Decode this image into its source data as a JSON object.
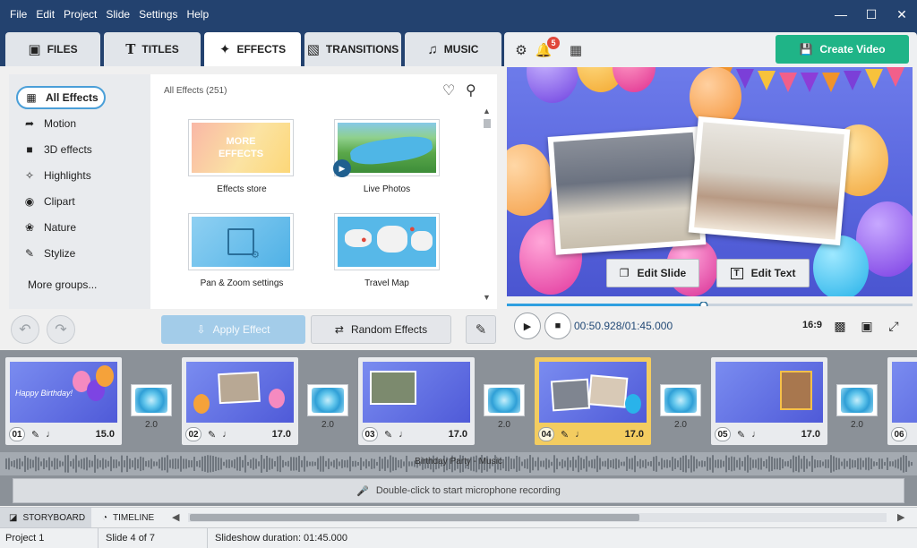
{
  "menu": [
    "File",
    "Edit",
    "Project",
    "Slide",
    "Settings",
    "Help"
  ],
  "tabs": [
    {
      "label": "FILES",
      "icon": "add-file-icon"
    },
    {
      "label": "TITLES",
      "icon": "text-icon"
    },
    {
      "label": "EFFECTS",
      "icon": "effects-icon",
      "active": true
    },
    {
      "label": "TRANSITIONS",
      "icon": "transitions-icon"
    },
    {
      "label": "MUSIC",
      "icon": "music-icon"
    }
  ],
  "notifications_count": "5",
  "create_video_label": "Create Video",
  "groups": [
    {
      "label": "All Effects",
      "active": true
    },
    {
      "label": "Motion"
    },
    {
      "label": "3D effects"
    },
    {
      "label": "Highlights"
    },
    {
      "label": "Clipart"
    },
    {
      "label": "Nature"
    },
    {
      "label": "Stylize"
    }
  ],
  "more_groups_label": "More groups...",
  "effects_header": "All Effects (251)",
  "effects": [
    {
      "label": "Effects store",
      "thumb_text": "MORE EFFECTS"
    },
    {
      "label": "Live Photos"
    },
    {
      "label": "Pan & Zoom settings"
    },
    {
      "label": "Travel Map"
    }
  ],
  "apply_effect_label": "Apply Effect",
  "random_effects_label": "Random Effects",
  "preview": {
    "edit_slide_label": "Edit Slide",
    "edit_text_label": "Edit Text",
    "time_current": "00:50.928",
    "time_total": "01:45.000",
    "aspect_ratio": "16:9",
    "progress": 0.485
  },
  "slides": [
    {
      "num": "01",
      "duration": "15.0",
      "caption": "Happy Birthday!"
    },
    {
      "num": "02",
      "duration": "17.0"
    },
    {
      "num": "03",
      "duration": "17.0"
    },
    {
      "num": "04",
      "duration": "17.0",
      "active": true
    },
    {
      "num": "05",
      "duration": "17.0"
    },
    {
      "num": "06",
      "duration": ""
    }
  ],
  "transitions": [
    {
      "duration": "2.0"
    },
    {
      "duration": "2.0"
    },
    {
      "duration": "2.0"
    },
    {
      "duration": "2.0"
    },
    {
      "duration": "2.0"
    }
  ],
  "audio_label": "Birthday Party - Music",
  "mic_label": "Double-click to start microphone recording",
  "bottom_tabs": {
    "storyboard": "STORYBOARD",
    "timeline": "TIMELINE"
  },
  "status": {
    "project": "Project 1",
    "slide": "Slide 4 of 7",
    "duration": "Slideshow duration: 01:45.000"
  },
  "colors": {
    "titlebar": "#23426f",
    "accent_green": "#1fb487",
    "active_slide": "#f3cc60",
    "preview_bg": "#5966de"
  }
}
